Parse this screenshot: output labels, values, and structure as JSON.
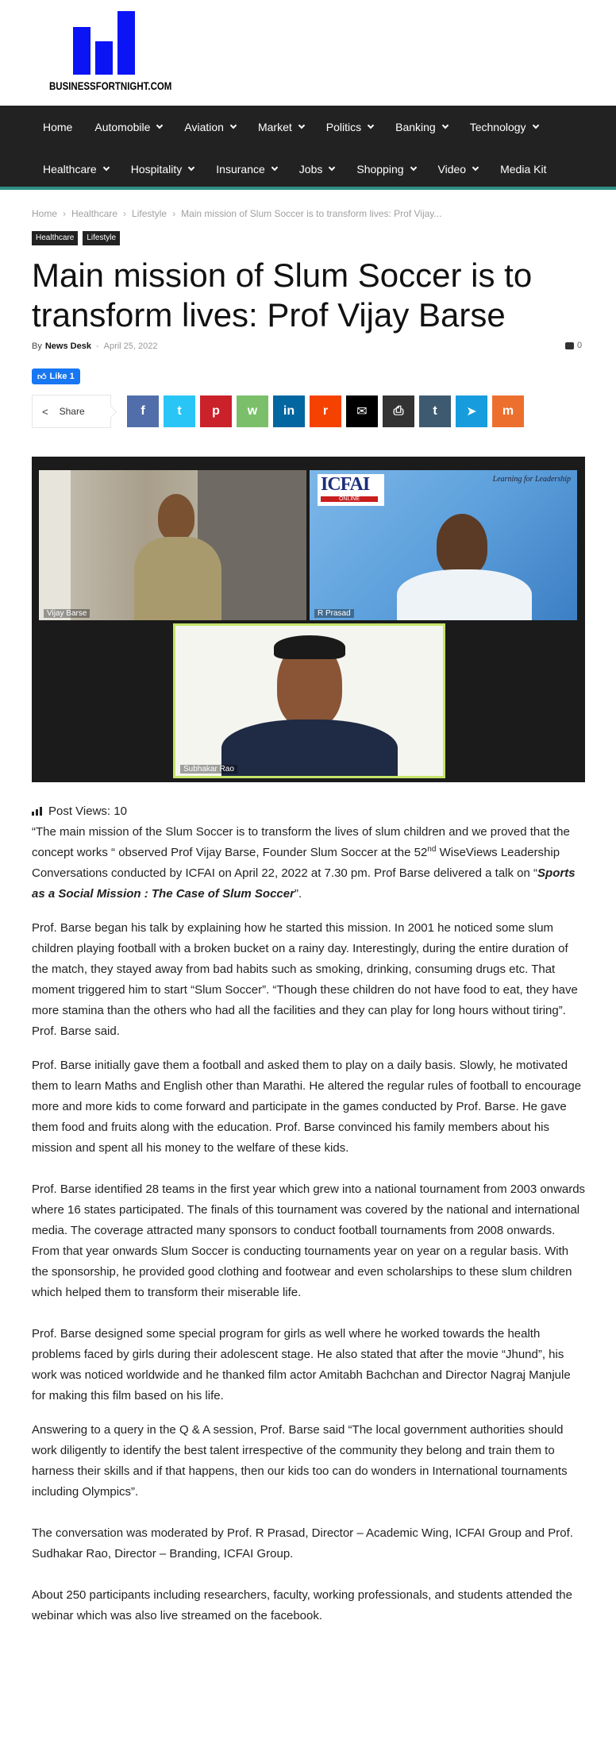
{
  "site": {
    "logo_text": "BUSINESSFORTNIGHT.COM",
    "brand_color": "#0a14f5"
  },
  "nav": {
    "row1": [
      {
        "label": "Home",
        "has_menu": false
      },
      {
        "label": "Automobile",
        "has_menu": true
      },
      {
        "label": "Aviation",
        "has_menu": true
      },
      {
        "label": "Market",
        "has_menu": true
      },
      {
        "label": "Politics",
        "has_menu": true
      },
      {
        "label": "Banking",
        "has_menu": true
      },
      {
        "label": "Technology",
        "has_menu": true
      }
    ],
    "row2": [
      {
        "label": "Healthcare",
        "has_menu": true
      },
      {
        "label": "Hospitality",
        "has_menu": true
      },
      {
        "label": "Insurance",
        "has_menu": true
      },
      {
        "label": "Jobs",
        "has_menu": true
      },
      {
        "label": "Shopping",
        "has_menu": true
      },
      {
        "label": "Video",
        "has_menu": true
      },
      {
        "label": "Media Kit",
        "has_menu": false
      }
    ],
    "accent_color": "#2d8f86"
  },
  "breadcrumb": [
    "Home",
    "Healthcare",
    "Lifestyle",
    "Main mission of Slum Soccer is to transform lives: Prof Vijay..."
  ],
  "categories": [
    "Healthcare",
    "Lifestyle"
  ],
  "article": {
    "title": "Main mission of Slum Soccer is to transform lives: Prof Vijay Barse",
    "by_label": "By",
    "author": "News Desk",
    "date": "April 25, 2022",
    "comment_count": "0",
    "fb_like_label": "Like 1",
    "share_label": "Share",
    "post_views_label": "Post Views: 10",
    "video_participants": [
      "Vijay Barse",
      "R Prasad",
      "Subhakar Rao"
    ],
    "video_brand": "ICFAI",
    "video_brand_sub": "ONLINE",
    "video_tagline": "Learning for Leadership",
    "p1_a": "“The main mission of the Slum Soccer is to transform the lives of slum children and we proved that the concept works “ observed Prof Vijay Barse, Founder Slum Soccer at the 52",
    "p1_sup": "nd",
    "p1_b": " WiseViews Leadership Conversations conducted by ICFAI on April 22, 2022 at 7.30 pm. Prof Barse delivered a talk on “",
    "p1_em": "Sports as a Social Mission : The Case of Slum Soccer",
    "p1_c": "”.",
    "p2": "Prof. Barse began his talk by explaining how he started this mission. In 2001 he noticed some slum children playing football with a broken bucket on a rainy day.  Interestingly, during the entire duration of the match, they stayed away from bad habits such as smoking, drinking, consuming drugs etc. That moment triggered him to start “Slum Soccer”. “Though these children do not have food to eat, they have more stamina than the others who had all the facilities and they can play for long hours without tiring”. Prof. Barse said.",
    "p3": "Prof. Barse initially gave them a football and asked them to play on a daily basis. Slowly, he motivated them to learn Maths and English other than Marathi. He altered the regular rules of football to encourage more and more kids to come forward and participate in the games conducted by Prof. Barse. He gave them food and fruits along with the education. Prof. Barse convinced his family members about his mission and spent all his money to the welfare of these kids.",
    "p4": "Prof. Barse identified 28 teams in the first year which grew into a national tournament from 2003 onwards where 16 states participated. The finals of this tournament was covered by the national and international media. The coverage attracted many sponsors to conduct football tournaments from 2008 onwards. From that year onwards Slum Soccer is conducting tournaments year on year on a regular basis. With the sponsorship, he provided good clothing and footwear and even scholarships to these slum children which helped them to transform their miserable life.",
    "p5": "Prof. Barse designed some special program for girls as well where he worked towards the health problems faced by girls during their adolescent stage. He also stated that after the movie “Jhund”, his work was noticed worldwide and he thanked film actor Amitabh Bachchan and Director Nagraj Manjule for making this film based on his life.",
    "p6": "Answering to a query in the Q & A session, Prof. Barse said “The local government authorities should work diligently to identify the best talent irrespective of the community they belong and train them to harness their skills and if that happens, then our kids too can do wonders in International tournaments including Olympics”.",
    "p7": "The conversation was moderated by Prof. R Prasad, Director – Academic Wing, ICFAI Group and Prof. Sudhakar Rao, Director – Branding, ICFAI Group.",
    "p8": "About 250 participants including researchers, faculty, working professionals, and students attended the webinar which was also live streamed on the facebook."
  },
  "share_buttons": [
    {
      "icon": "facebook-icon",
      "glyph": "f",
      "color": "#516eab"
    },
    {
      "icon": "twitter-icon",
      "glyph": "t",
      "color": "#29c5f6"
    },
    {
      "icon": "pinterest-icon",
      "glyph": "p",
      "color": "#ca212a"
    },
    {
      "icon": "whatsapp-icon",
      "glyph": "w",
      "color": "#7bbf6a"
    },
    {
      "icon": "linkedin-icon",
      "glyph": "in",
      "color": "#0266a0"
    },
    {
      "icon": "reddit-icon",
      "glyph": "r",
      "color": "#f54200"
    },
    {
      "icon": "email-icon",
      "glyph": "✉",
      "color": "#000000"
    },
    {
      "icon": "print-icon",
      "glyph": "⎙",
      "color": "#333333"
    },
    {
      "icon": "tumblr-icon",
      "glyph": "t",
      "color": "#3e5a70"
    },
    {
      "icon": "telegram-icon",
      "glyph": "➤",
      "color": "#179cde"
    },
    {
      "icon": "mix-icon",
      "glyph": "m",
      "color": "#ed6f2d"
    }
  ]
}
